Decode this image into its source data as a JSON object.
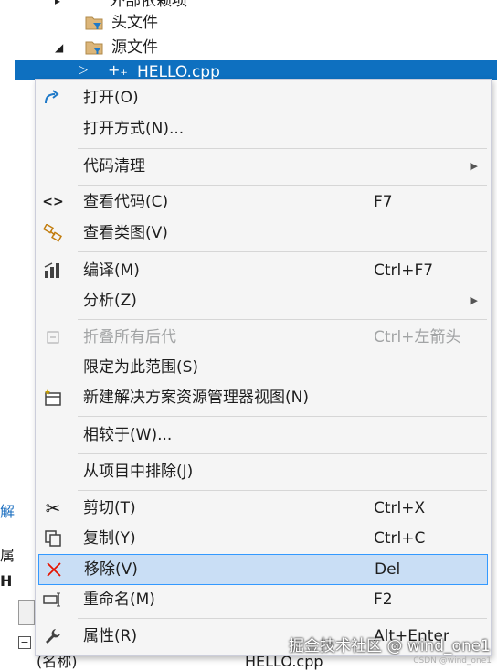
{
  "tree": {
    "top_partial": "外部依赖项",
    "header_folder": "头文件",
    "source_folder": "源文件",
    "selected_file": "HELLO.cpp"
  },
  "left_strip": {
    "solution_tab": "解",
    "properties_tab": "属",
    "header_h": "H"
  },
  "bottom": {
    "name_label": "(名称)",
    "name_value": "HELLO.cpp"
  },
  "menu": {
    "open": "打开(O)",
    "open_with": "打开方式(N)...",
    "code_cleanup": "代码清理",
    "view_code": "查看代码(C)",
    "view_code_key": "F7",
    "view_class_diagram": "查看类图(V)",
    "compile": "编译(M)",
    "compile_key": "Ctrl+F7",
    "analyze": "分析(Z)",
    "collapse_all": "折叠所有后代",
    "collapse_all_key": "Ctrl+左箭头",
    "scope_to_this": "限定为此范围(S)",
    "new_view": "新建解决方案资源管理器视图(N)",
    "compare_with": "相较于(W)...",
    "exclude": "从项目中排除(J)",
    "cut": "剪切(T)",
    "cut_key": "Ctrl+X",
    "copy": "复制(Y)",
    "copy_key": "Ctrl+C",
    "remove": "移除(V)",
    "remove_key": "Del",
    "rename": "重命名(M)",
    "rename_key": "F2",
    "properties": "属性(R)",
    "properties_key": "Alt+Enter"
  },
  "watermark": "掘金技术社区 @ wind_one1",
  "csdn_mark": "CSDN @wind_one1",
  "colors": {
    "selection_blue": "#0e70c0",
    "menu_bg": "#f5f5f5",
    "highlight_bg": "#c9def5",
    "highlight_border": "#3399ff",
    "disabled_text": "#a2a4a5",
    "remove_icon": "#e51400",
    "folder": "#dcb67a"
  }
}
